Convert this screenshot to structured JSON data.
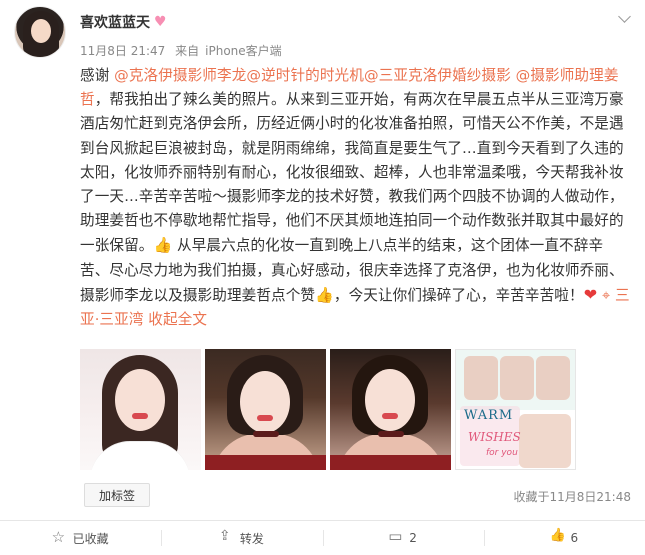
{
  "post": {
    "username": "喜欢蓝蓝天",
    "vip_icon": "pink-heart-badge",
    "meta": {
      "time": "11月8日 21:47",
      "source_prefix": "来自",
      "source": "iPhone客户端"
    },
    "content": {
      "seg1": "感谢",
      "mentions": [
        "@克洛伊摄影师李龙",
        "@逆时针的时光机",
        "@三亚克洛伊婚纱摄影",
        "@摄影师助理姜哲"
      ],
      "seg2": "，帮我拍出了辣么美的照片。从来到三亚开始，有两次在早晨五点半从三亚湾万豪酒店匆忙赶到克洛伊会所，历经近俩小时的化妆准备拍照，可惜天公不作美，不是遇到台风掀起巨浪被封岛，就是阴雨绵绵，我简直是要生气了…直到今天看到了久违的太阳，化妆师乔丽特别有耐心，化妆很细致、超棒，人也非常温柔哦，今天帮我补妆了一天…辛苦辛苦啦～摄影师李龙的技术好赞，教我们两个四肢不协调的人做动作，助理姜哲也不停歇地帮忙指导，他们不厌其烦地连拍同一个动作数张并取其中最好的一张保留。",
      "seg3": "从早晨六点的化妆一直到晚上八点半的结束，这个团体一直不辞辛苦、尽心尽力地为我们拍摄，真心好感动，很庆幸选择了克洛伊，也为化妆师乔丽、摄影师李龙以及摄影助理姜哲点个赞",
      "seg4": "，今天让你们操碎了心，辛苦辛苦啦！",
      "location": "三亚·三亚湾",
      "expand": "收起全文"
    },
    "photo4_text": {
      "warm": "WARM",
      "wishes": "WISHES",
      "for_you": "for you"
    },
    "tag_button": "加标签",
    "fav_time": "收藏于11月8日21:48",
    "actions": {
      "favorite": "已收藏",
      "forward": "转发",
      "comment": "2",
      "like": "6"
    }
  }
}
